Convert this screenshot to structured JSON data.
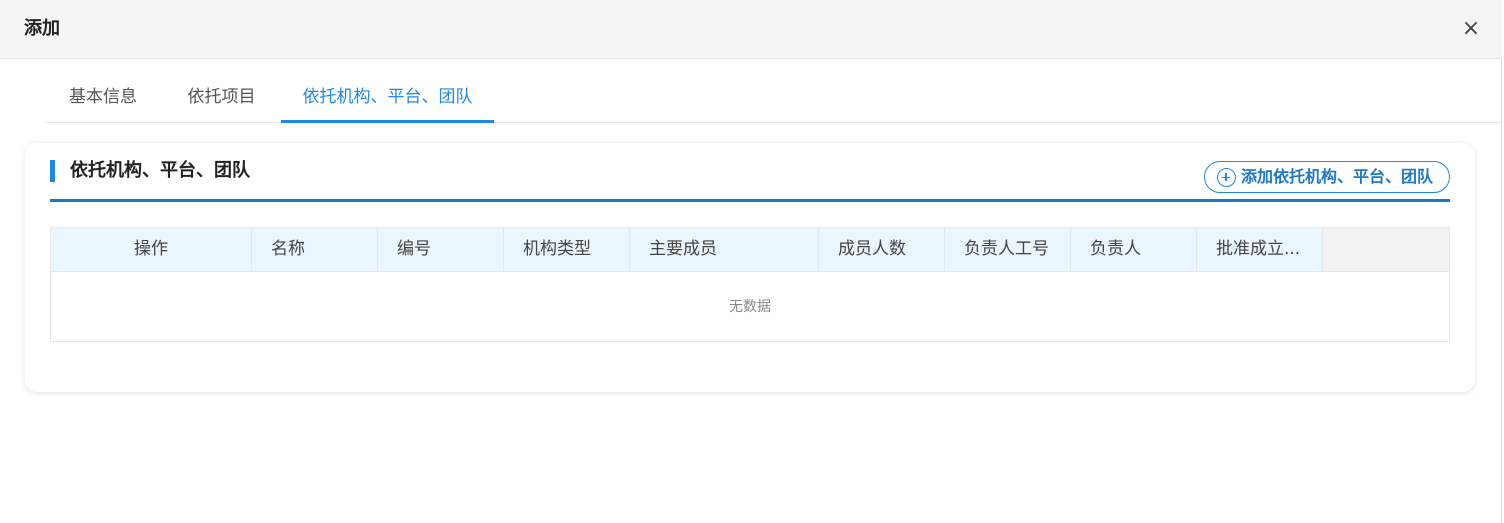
{
  "dialog": {
    "title": "添加",
    "close_label": "×"
  },
  "tabs": [
    {
      "label": "基本信息",
      "active": false
    },
    {
      "label": "依托项目",
      "active": false
    },
    {
      "label": "依托机构、平台、团队",
      "active": true
    }
  ],
  "section": {
    "title": "依托机构、平台、团队",
    "add_button_label": "添加依托机构、平台、团队"
  },
  "table": {
    "columns": [
      "操作",
      "名称",
      "编号",
      "机构类型",
      "主要成员",
      "成员人数",
      "负责人工号",
      "负责人",
      "批准成立..."
    ],
    "empty_text": "无数据"
  },
  "colors": {
    "accent": "#1e88e5",
    "header_bg": "#f5f5f5",
    "table_head_bg": "#ebf5fd"
  }
}
